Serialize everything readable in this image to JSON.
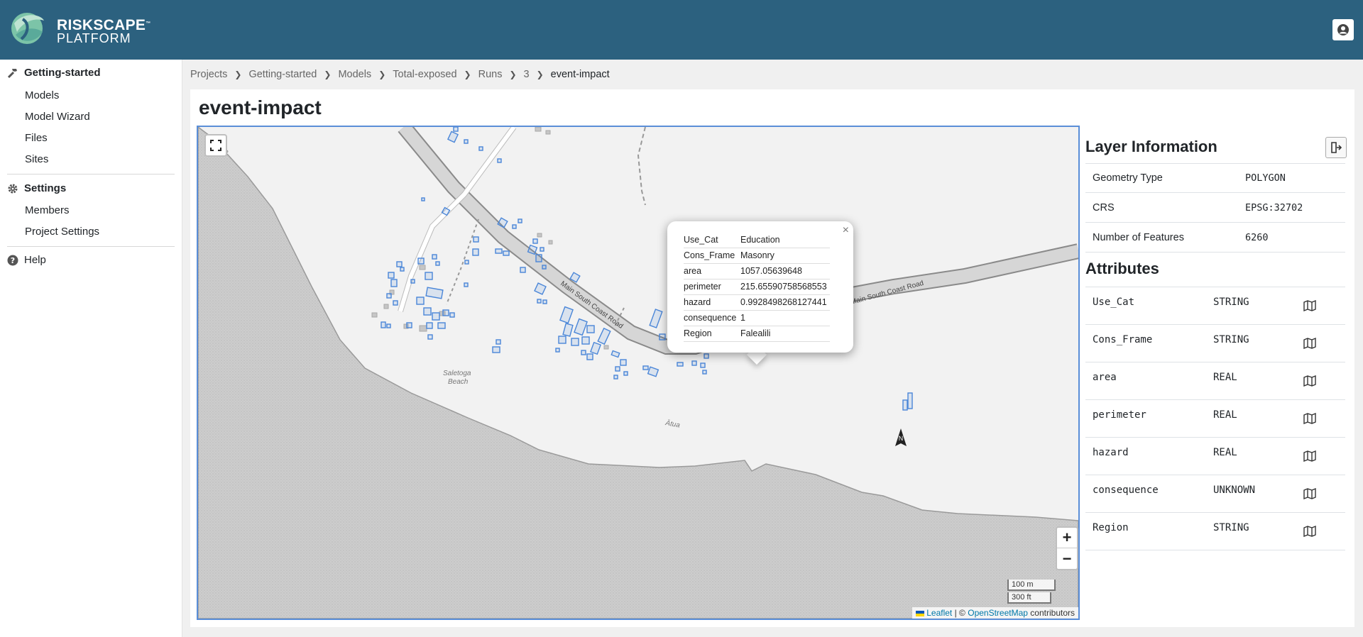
{
  "header": {
    "logo_line1": "RISKSCAPE",
    "logo_line2": "PLATFORM",
    "logo_tm": "™",
    "user_icon": "user-circle-icon"
  },
  "sidebar": {
    "project": {
      "label": "Getting-started",
      "icon": "hammer-icon"
    },
    "project_items": [
      {
        "label": "Models"
      },
      {
        "label": "Model Wizard"
      },
      {
        "label": "Files"
      },
      {
        "label": "Sites"
      }
    ],
    "settings": {
      "label": "Settings",
      "icon": "gear-icon"
    },
    "settings_items": [
      {
        "label": "Members"
      },
      {
        "label": "Project Settings"
      }
    ],
    "help": {
      "label": "Help",
      "icon": "question-circle-icon"
    }
  },
  "breadcrumb": [
    "Projects",
    "Getting-started",
    "Models",
    "Total-exposed",
    "Runs",
    "3",
    "event-impact"
  ],
  "page": {
    "title": "event-impact"
  },
  "map": {
    "labels": {
      "road1": "Main South Coast Road",
      "road2": "Main South Coast Road",
      "beach": "Saletoga",
      "beach2": "Beach",
      "atua": "Ātua",
      "ua": "ua"
    },
    "zoom_in": "+",
    "zoom_out": "−",
    "scale_m": "100 m",
    "scale_ft": "300 ft",
    "attribution": {
      "leaflet": "Leaflet",
      "sep": "| ©",
      "osm": "OpenStreetMap",
      "contributors": "contributors"
    },
    "popup": {
      "close": "×",
      "rows": [
        {
          "key": "Use_Cat",
          "value": "Education"
        },
        {
          "key": "Cons_Frame",
          "value": "Masonry"
        },
        {
          "key": "area",
          "value": "1057.05639648"
        },
        {
          "key": "perimeter",
          "value": "215.65590758568553"
        },
        {
          "key": "hazard",
          "value": "0.9928498268127441"
        },
        {
          "key": "consequence",
          "value": "1"
        },
        {
          "key": "Region",
          "value": "Falealili"
        }
      ]
    }
  },
  "layer_info": {
    "title": "Layer Information",
    "rows": [
      {
        "key": "Geometry Type",
        "value": "POLYGON"
      },
      {
        "key": "CRS",
        "value": "EPSG:32702"
      },
      {
        "key": "Number of Features",
        "value": "6260"
      }
    ],
    "attributes_title": "Attributes",
    "attributes": [
      {
        "name": "Use_Cat",
        "type": "STRING"
      },
      {
        "name": "Cons_Frame",
        "type": "STRING"
      },
      {
        "name": "area",
        "type": "REAL"
      },
      {
        "name": "perimeter",
        "type": "REAL"
      },
      {
        "name": "hazard",
        "type": "REAL"
      },
      {
        "name": "consequence",
        "type": "UNKNOWN"
      },
      {
        "name": "Region",
        "type": "STRING"
      }
    ]
  },
  "colors": {
    "header": "#2c617f",
    "map_border": "#5a8ed8",
    "feature": "#4a86d8",
    "sea": "#c8c8c8"
  }
}
